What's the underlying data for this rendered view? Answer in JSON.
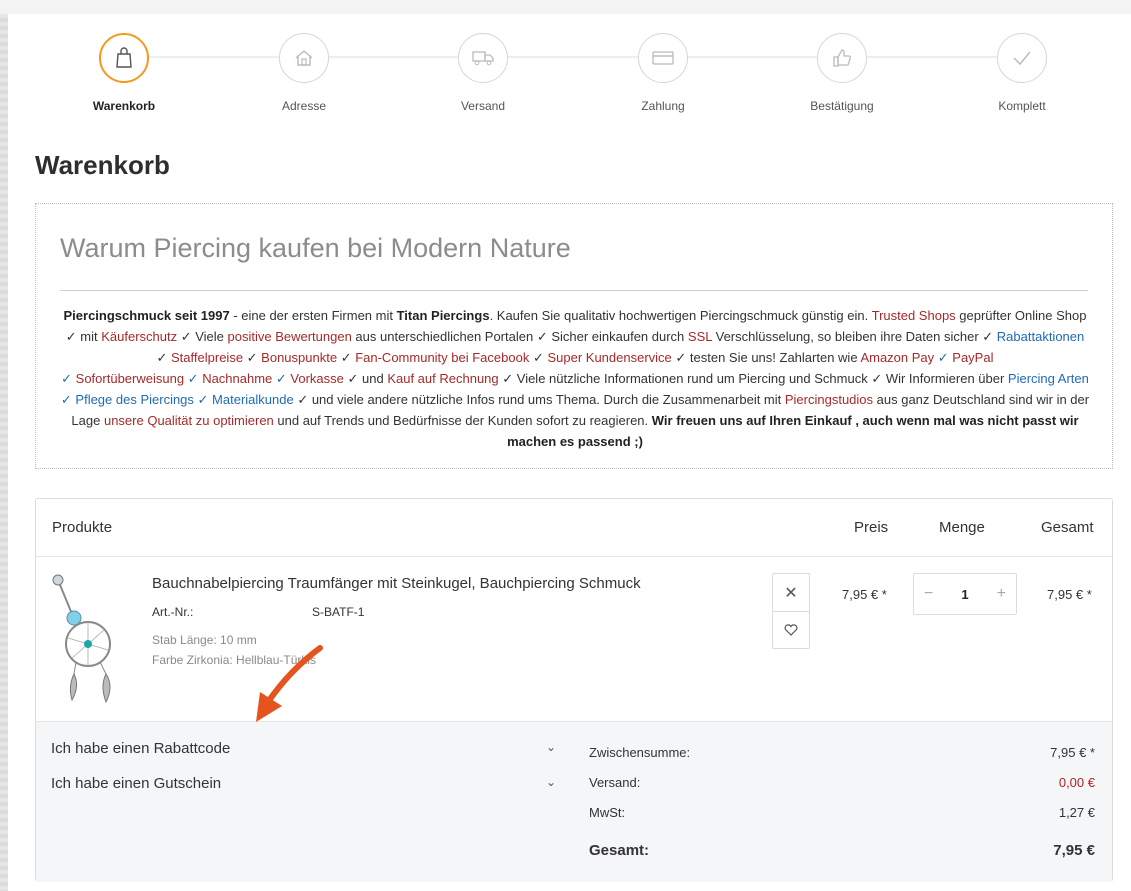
{
  "steps": [
    {
      "label": "Warenkorb",
      "icon": "shopping-bag-icon",
      "active": true
    },
    {
      "label": "Adresse",
      "icon": "house-icon"
    },
    {
      "label": "Versand",
      "icon": "truck-icon"
    },
    {
      "label": "Zahlung",
      "icon": "credit-card-icon"
    },
    {
      "label": "Bestätigung",
      "icon": "thumbs-up-icon"
    },
    {
      "label": "Komplett",
      "icon": "checkmark-icon"
    }
  ],
  "page_title": "Warenkorb",
  "info": {
    "heading": "Warum Piercing kaufen bei Modern Nature",
    "t01": "Piercingschmuck seit 1997",
    "t02": " -  eine der ersten Firmen mit ",
    "t03": "Titan Piercings",
    "t04": ". Kaufen Sie qualitativ hochwertigen Piercingschmuck günstig ein. ",
    "t05": "Trusted Shops",
    "t06": " geprüfter Online Shop ✓ mit ",
    "t07": "Käuferschutz",
    "t08": " ✓ Viele ",
    "t09": "positive Bewertungen",
    "t10": " aus unterschiedlichen Portalen ✓ Sicher einkaufen durch ",
    "t11": "SSL",
    "t12": " Verschlüsselung, so bleiben ihre Daten sicher ✓ ",
    "t13": "Rabattaktionen",
    "t14": " ✓ ",
    "t15": "Staffelpreise",
    "t16": " ✓ ",
    "t17": "Bonuspunkte",
    "t18": " ✓ ",
    "t19": "Fan-Community bei Facebook",
    "t20": " ✓ ",
    "t21": "Super Kundenservice",
    "t22": " ✓ testen Sie uns! Zahlarten wie ",
    "t23": "Amazon Pay",
    "t24": " ✓ ",
    "t25": "PayPal",
    "t26": " ✓ ",
    "t27": "Sofortüberweisung",
    "t28": " ✓ ",
    "t29": "Nachnahme",
    "t30": " ✓ ",
    "t31": "Vorkasse",
    "t32": " ✓ und ",
    "t33": "Kauf auf Rechnung",
    "t34": " ✓ Viele nützliche Informationen rund um Piercing und Schmuck ✓ Wir Informieren über ",
    "t35": "Piercing Arten",
    "t36": " ✓ ",
    "t37": "Pflege des Piercings",
    "t38": " ✓ ",
    "t39": "Materialkunde",
    "t40": " ✓ und viele andere nützliche Infos rund ums Thema. Durch die Zusammenarbeit mit ",
    "t41": "Piercingstudios",
    "t42": " aus ganz Deutschland sind wir in der Lage ",
    "t43": "unsere Qualität zu optimieren",
    "t44": " und auf Trends und Bedürfnisse der Kunden sofort zu reagieren.  ",
    "t45": "Wir freuen uns auf Ihren Einkauf , auch wenn mal was nicht passt wir machen es passend ;)"
  },
  "cart": {
    "headers": {
      "products": "Produkte",
      "price": "Preis",
      "qty": "Menge",
      "total": "Gesamt"
    },
    "item": {
      "name": "Bauchnabelpiercing Traumfänger mit Steinkugel, Bauchpiercing Schmuck",
      "art_label": "Art.-Nr.:",
      "art_value": "S-BATF-1",
      "attr1": "Stab Länge: 10 mm",
      "attr2": "Farbe Zirkonia: Hellblau-Türkis",
      "price": "7,95 € *",
      "minus": "−",
      "qty": "1",
      "plus": "+",
      "total": "7,95 € *",
      "remove_icon": "close-icon",
      "wishlist_icon": "heart-icon"
    },
    "toggles": {
      "rabatt": "Ich habe einen Rabattcode",
      "gutschein": "Ich habe einen Gutschein"
    },
    "summary": {
      "subtotal_label": "Zwischensumme:",
      "subtotal": "7,95 € *",
      "shipping_label": "Versand:",
      "shipping": "0,00 €",
      "tax_label": "MwSt:",
      "tax": "1,27 €",
      "total_label": "Gesamt:",
      "total": "7,95 €"
    }
  },
  "colors": {
    "accent": "#f39a1e",
    "link_red": "#a52a2a",
    "link_blue": "#1f6bb5",
    "arrow": "#e5531f"
  }
}
